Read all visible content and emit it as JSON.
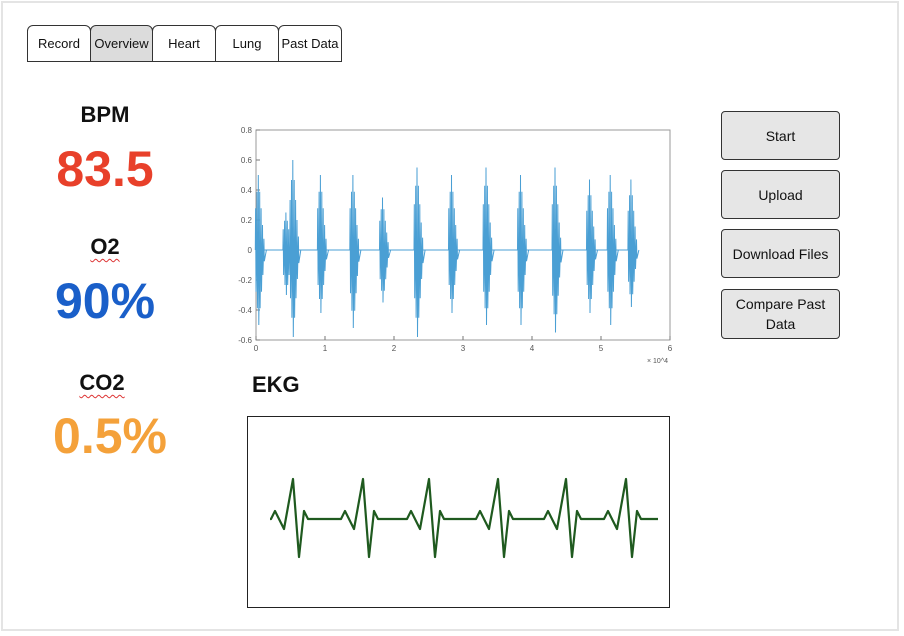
{
  "tabs": [
    {
      "label": "Record",
      "active": false
    },
    {
      "label": "Overview",
      "active": true
    },
    {
      "label": "Heart",
      "active": false
    },
    {
      "label": "Lung",
      "active": false
    },
    {
      "label": "Past Data",
      "active": false
    }
  ],
  "metrics": {
    "bpm": {
      "label": "BPM",
      "value": "83.5",
      "color": "#e8402a"
    },
    "o2": {
      "label": "O2",
      "value": "90%",
      "color": "#1a5fc9"
    },
    "co2": {
      "label": "CO2",
      "value": "0.5%",
      "color": "#f4a13a"
    }
  },
  "buttons": {
    "start": "Start",
    "upload": "Upload",
    "download": "Download Files",
    "compare": "Compare Past Data"
  },
  "ekg": {
    "title": "EKG",
    "trace_color": "#1f5a1f"
  },
  "chart_data": {
    "type": "line",
    "title": "",
    "xlabel": "",
    "ylabel": "",
    "x_multiplier": "× 10^4",
    "xlim": [
      0,
      6
    ],
    "ylim": [
      -0.6,
      0.8
    ],
    "x_ticks": [
      "0",
      "1",
      "2",
      "3",
      "4",
      "5",
      "6"
    ],
    "y_ticks": [
      "0.8",
      "0.6",
      "0.4",
      "0.2",
      "0",
      "-0.2",
      "-0.4",
      "-0.6"
    ],
    "series_color": "#4a9fd4",
    "beats": [
      {
        "x": 0.05,
        "max": 0.5,
        "min": -0.5
      },
      {
        "x": 0.45,
        "max": 0.25,
        "min": -0.3
      },
      {
        "x": 0.55,
        "max": 0.6,
        "min": -0.58
      },
      {
        "x": 0.95,
        "max": 0.5,
        "min": -0.42
      },
      {
        "x": 1.42,
        "max": 0.5,
        "min": -0.52
      },
      {
        "x": 1.85,
        "max": 0.35,
        "min": -0.35
      },
      {
        "x": 2.35,
        "max": 0.55,
        "min": -0.58
      },
      {
        "x": 2.85,
        "max": 0.5,
        "min": -0.42
      },
      {
        "x": 3.35,
        "max": 0.55,
        "min": -0.5
      },
      {
        "x": 3.85,
        "max": 0.5,
        "min": -0.5
      },
      {
        "x": 4.35,
        "max": 0.55,
        "min": -0.55
      },
      {
        "x": 4.85,
        "max": 0.47,
        "min": -0.42
      },
      {
        "x": 5.15,
        "max": 0.5,
        "min": -0.5
      },
      {
        "x": 5.45,
        "max": 0.47,
        "min": -0.38
      }
    ]
  }
}
